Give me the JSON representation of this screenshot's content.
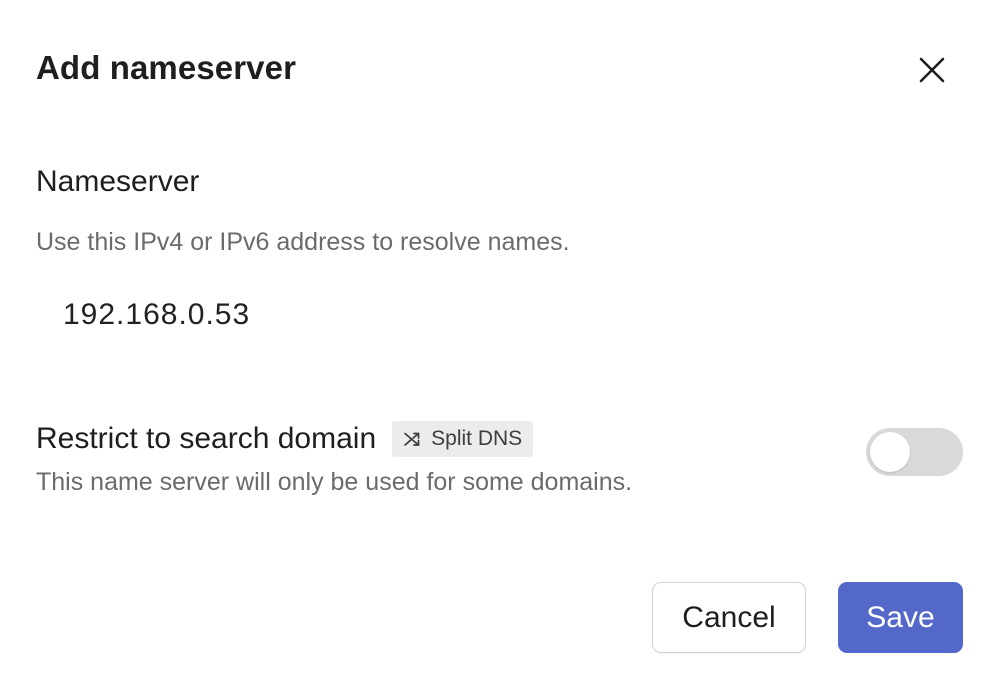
{
  "dialog": {
    "title": "Add nameserver",
    "close_icon": "close-icon"
  },
  "nameserver": {
    "title": "Nameserver",
    "description": "Use this IPv4 or IPv6 address to resolve names.",
    "value": "192.168.0.53"
  },
  "restrict": {
    "title": "Restrict to search domain",
    "badge_label": "Split DNS",
    "badge_icon": "shuffle-icon",
    "description": "This name server will only be used for some domains.",
    "enabled": false
  },
  "actions": {
    "cancel_label": "Cancel",
    "save_label": "Save"
  },
  "colors": {
    "primary": "#5468c9",
    "toggle_off": "#d9d9d9",
    "badge_bg": "#ececec",
    "muted_text": "#6b6b6b"
  }
}
